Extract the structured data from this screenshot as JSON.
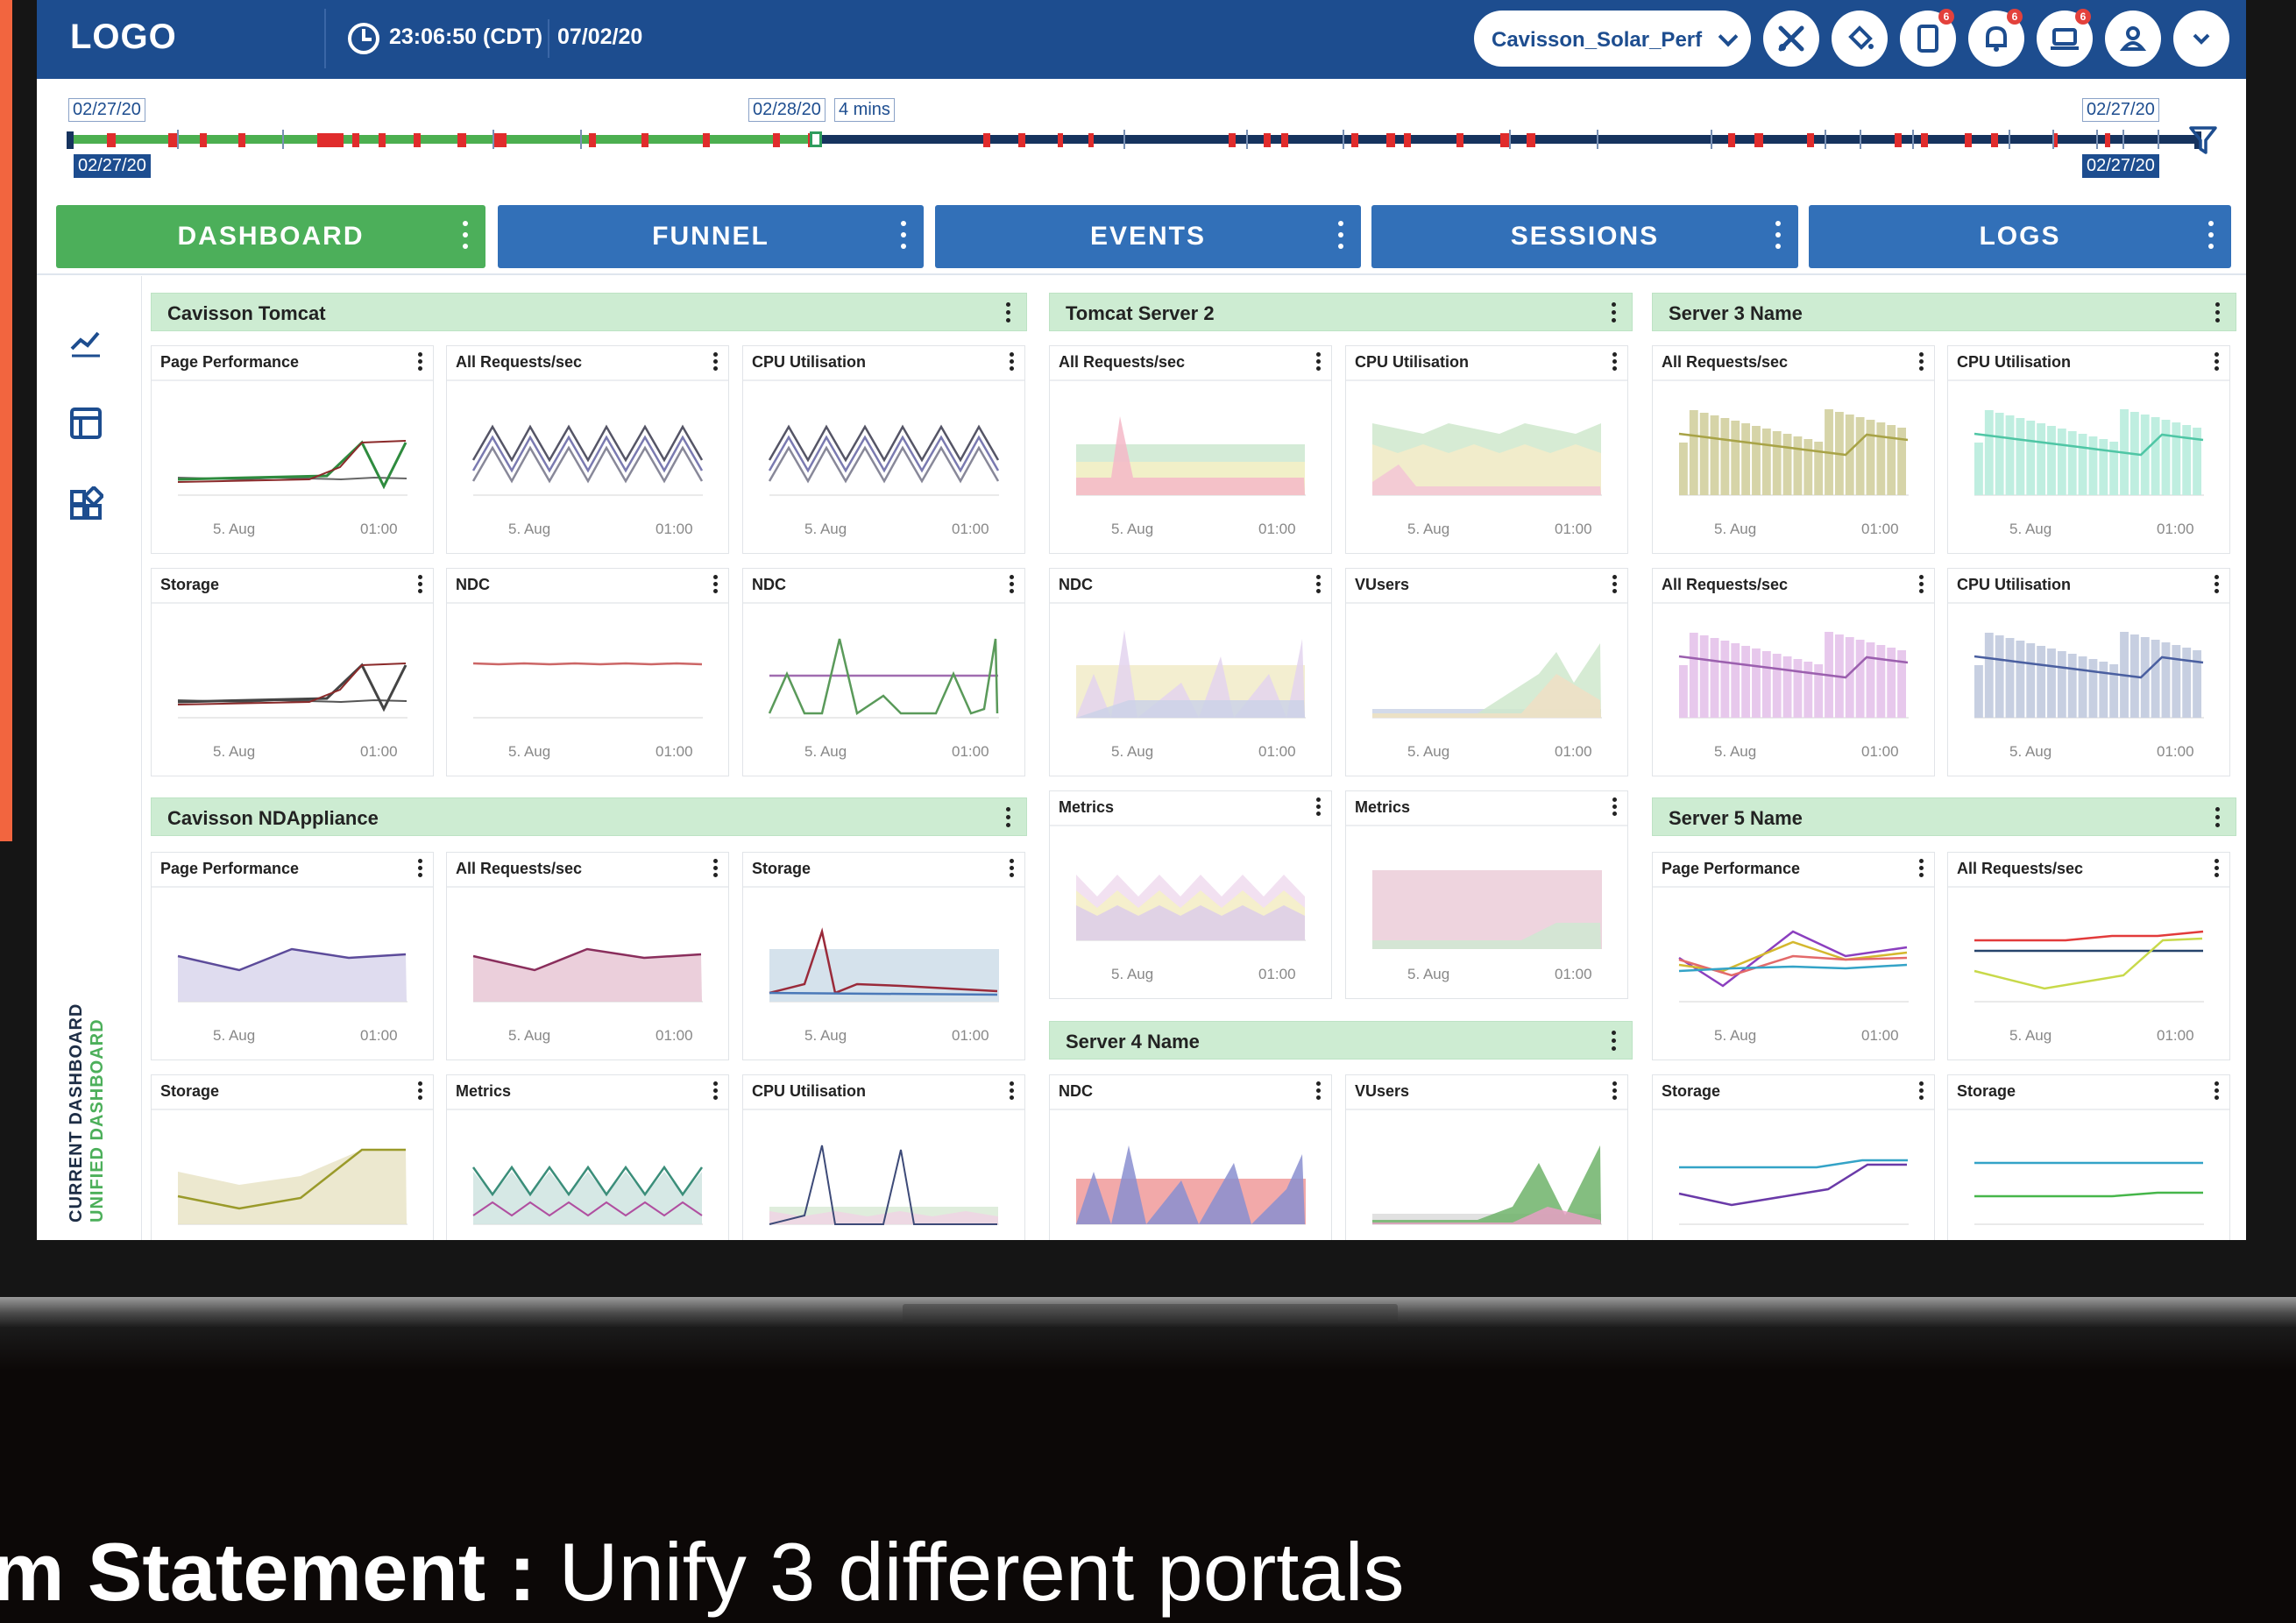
{
  "header": {
    "logo": "LOGO",
    "time": "23:06:50 (CDT)",
    "date": "07/02/20",
    "project": "Cavisson_Solar_Perf",
    "notification_counts": {
      "reports": "6",
      "alerts": "6",
      "monitors": "6"
    }
  },
  "timeline": {
    "start_top": "02/27/20",
    "start_bottom": "02/27/20",
    "cursor_date": "02/28/20",
    "cursor_duration": "4 mins",
    "end_top": "02/27/20",
    "end_bottom": "02/27/20"
  },
  "tabs": [
    {
      "label": "DASHBOARD",
      "active": true
    },
    {
      "label": "FUNNEL",
      "active": false
    },
    {
      "label": "EVENTS",
      "active": false
    },
    {
      "label": "SESSIONS",
      "active": false
    },
    {
      "label": "LOGS",
      "active": false
    }
  ],
  "side_labels": {
    "current": "CURRENT DASHBOARD",
    "unified": "UNIFIED DASHBOARD"
  },
  "groups": [
    {
      "title": "Cavisson Tomcat"
    },
    {
      "title": "Tomcat Server 2"
    },
    {
      "title": "Server 3 Name"
    },
    {
      "title": "Cavisson NDAppliance"
    },
    {
      "title": "Server 5 Name"
    },
    {
      "title": "Server 4 Name"
    }
  ],
  "axis": {
    "left": "5. Aug",
    "right": "01:00"
  },
  "panels": [
    {
      "title": "Page Performance"
    },
    {
      "title": "All Requests/sec"
    },
    {
      "title": "CPU Utilisation"
    },
    {
      "title": "Storage"
    },
    {
      "title": "NDC"
    },
    {
      "title": "NDC"
    },
    {
      "title": "All Requests/sec"
    },
    {
      "title": "CPU Utilisation"
    },
    {
      "title": "NDC"
    },
    {
      "title": "VUsers"
    },
    {
      "title": "All Requests/sec"
    },
    {
      "title": "CPU Utilisation"
    },
    {
      "title": "All Requests/sec"
    },
    {
      "title": "CPU Utilisation"
    },
    {
      "title": "Page Performance"
    },
    {
      "title": "All Requests/sec"
    },
    {
      "title": "Storage"
    },
    {
      "title": "Metrics"
    },
    {
      "title": "Metrics"
    },
    {
      "title": "Page Performance"
    },
    {
      "title": "All Requests/sec"
    },
    {
      "title": "Storage"
    },
    {
      "title": "Metrics"
    },
    {
      "title": "CPU Utilisation"
    },
    {
      "title": "NDC"
    },
    {
      "title": "VUsers"
    },
    {
      "title": "Storage"
    },
    {
      "title": "Storage"
    }
  ],
  "caption": {
    "bold": "m Statement :",
    "rest": " Unify 3 different portals"
  },
  "colors": {
    "brand": "#1d4d8f",
    "active_tab": "#4caf5a",
    "tab": "#3270b8",
    "group_header": "#cdecd2",
    "accent_orange": "#f2653f"
  }
}
